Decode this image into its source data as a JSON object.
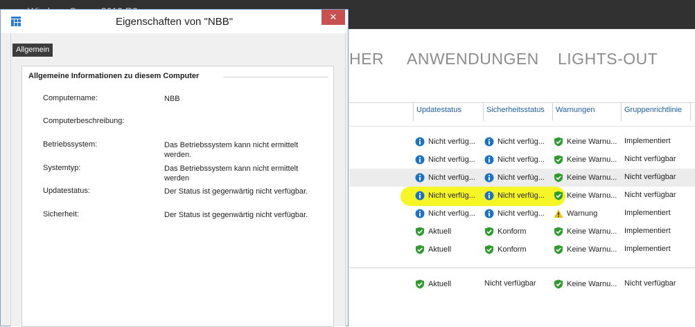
{
  "background_window": {
    "title": "Windows Server 2012 R2",
    "nav_tabs": [
      "HER",
      "ANWENDUNGEN",
      "LIGHTS-OUT"
    ],
    "columns": [
      "Updatestatus",
      "Sicherheitsstatus",
      "Warnungen",
      "Gruppenrichtlinie"
    ],
    "rows": [
      {
        "update": {
          "icon": "info-icon",
          "text": "Nicht verfüg..."
        },
        "security": {
          "icon": "info-icon",
          "text": "Nicht verfüg..."
        },
        "warnings": {
          "icon": "check-icon",
          "text": "Keine Warnu..."
        },
        "policy": "Implementiert",
        "alt": false,
        "highlight": false
      },
      {
        "update": {
          "icon": "info-icon",
          "text": "Nicht verfüg..."
        },
        "security": {
          "icon": "info-icon",
          "text": "Nicht verfüg..."
        },
        "warnings": {
          "icon": "check-icon",
          "text": "Keine Warnu..."
        },
        "policy": "Nicht verfügbar",
        "alt": false,
        "highlight": false
      },
      {
        "update": {
          "icon": "info-icon",
          "text": "Nicht verfüg..."
        },
        "security": {
          "icon": "info-icon",
          "text": "Nicht verfüg..."
        },
        "warnings": {
          "icon": "check-icon",
          "text": "Keine Warnu..."
        },
        "policy": "Nicht verfügbar",
        "alt": true,
        "highlight": false
      },
      {
        "update": {
          "icon": "info-icon",
          "text": "Nicht verfüg..."
        },
        "security": {
          "icon": "info-icon",
          "text": "Nicht verfüg..."
        },
        "warnings": {
          "icon": "check-icon",
          "text": "Keine Warnu..."
        },
        "policy": "Nicht verfügbar",
        "alt": false,
        "highlight": true
      },
      {
        "update": {
          "icon": "info-icon",
          "text": "Nicht verfüg..."
        },
        "security": {
          "icon": "info-icon",
          "text": "Nicht verfüg..."
        },
        "warnings": {
          "icon": "warning-icon",
          "text": "Warnung"
        },
        "policy": "Implementiert",
        "alt": false,
        "highlight": false
      },
      {
        "update": {
          "icon": "check-icon",
          "text": "Aktuell"
        },
        "security": {
          "icon": "check-icon",
          "text": "Konform"
        },
        "warnings": {
          "icon": "check-icon",
          "text": "Keine Warnu..."
        },
        "policy": "Implementiert",
        "alt": false,
        "highlight": false
      },
      {
        "update": {
          "icon": "check-icon",
          "text": "Aktuell"
        },
        "security": {
          "icon": "check-icon",
          "text": "Konform"
        },
        "warnings": {
          "icon": "check-icon",
          "text": "Keine Warnu..."
        },
        "policy": "Implementiert",
        "alt": false,
        "highlight": false
      },
      {
        "update": {
          "icon": "check-icon",
          "text": "Aktuell"
        },
        "security": {
          "icon": "",
          "text": "Nicht verfügbar"
        },
        "warnings": {
          "icon": "check-icon",
          "text": "Keine Warnu..."
        },
        "policy": "Nicht verfügbar",
        "alt": false,
        "highlight": false
      }
    ]
  },
  "dialog": {
    "title": "Eigenschaften von \"NBB\"",
    "close_label": "✕",
    "tab_label": "Allgemein",
    "section_title": "Allgemeine Informationen zu diesem Computer",
    "properties": [
      {
        "label": "Computername:",
        "value": "NBB"
      },
      {
        "label": "Computerbeschreibung:",
        "value": ""
      },
      {
        "label": "Betriebssystem:",
        "value": "Das Betriebssystem kann nicht ermittelt werden."
      },
      {
        "label": "Systemtyp:",
        "value": "Das Betriebssystem kann nicht ermittelt werden"
      },
      {
        "label": "Updatestatus:",
        "value": "Der Status ist gegenwärtig nicht verfügbar."
      },
      {
        "label": "Sicherheit:",
        "value": "Der Status ist gegenwärtig nicht verfügbar."
      }
    ]
  },
  "colors": {
    "info": "#1a73c9",
    "check": "#2e9b2e",
    "warning": "#f2c200",
    "highlight": "#f4f400",
    "header_link": "#1f5fa8"
  }
}
